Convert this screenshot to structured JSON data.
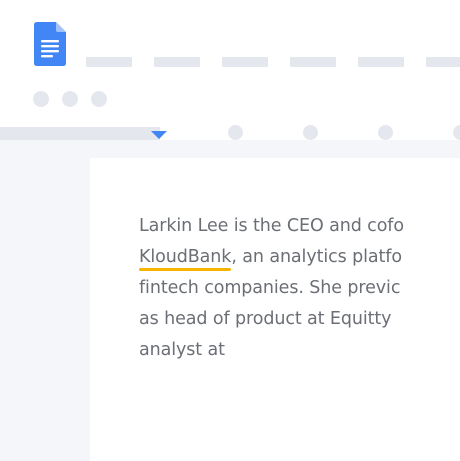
{
  "header": {
    "app_icon": "google-docs-icon",
    "menu_items": 6,
    "toolbar_dots": 3
  },
  "ruler": {
    "indent_marker_color": "#4285f4",
    "dots": 4
  },
  "document": {
    "lines": [
      {
        "text": "Larkin Lee is the CEO and cofo"
      },
      {
        "link": "KloudBank",
        "text": ", an analytics platfo"
      },
      {
        "text": "fintech companies. She previc"
      },
      {
        "text": "as head of product at Equitty"
      },
      {
        "text": "analyst at"
      }
    ],
    "link_underline_color": "#f9b400"
  },
  "colors": {
    "doc_icon": "#4285f4",
    "placeholder": "#e4e7ee",
    "canvas": "#f5f6f9",
    "text": "#6b6f75"
  }
}
